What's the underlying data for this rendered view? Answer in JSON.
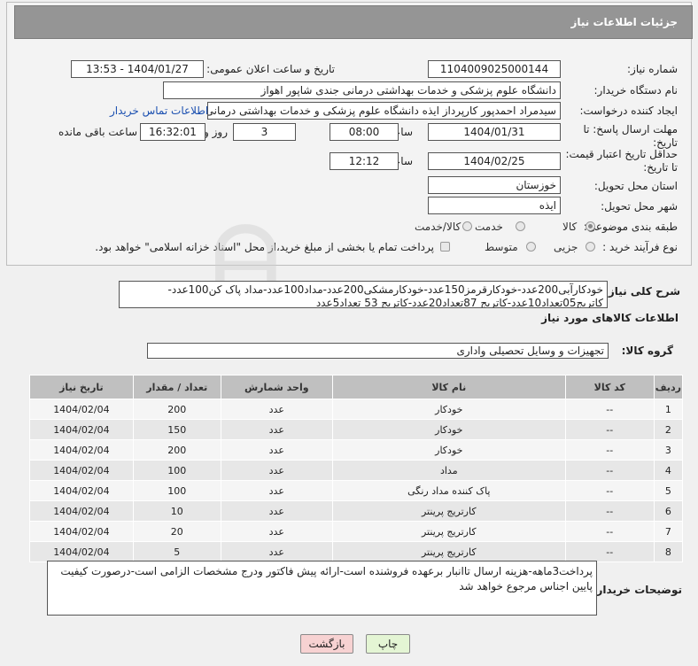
{
  "header": {
    "title": "جزئیات اطلاعات نیاز"
  },
  "fields": {
    "need_number_label": "شماره نیاز:",
    "need_number": "1104009025000144",
    "announce_label": "تاریخ و ساعت اعلان عمومی:",
    "announce_value": "1404/01/27 - 13:53",
    "buyer_org_label": "نام دستگاه خریدار:",
    "buyer_org": "دانشگاه علوم پزشکی و خدمات بهداشتی درمانی جندی شاپور اهواز",
    "creator_label": "ایجاد کننده درخواست:",
    "creator": "سیدمراد احمدپور کارپرداز ایذه دانشگاه علوم پزشکی و خدمات بهداشتی درمانی",
    "contact_link": "اطلاعات تماس خریدار",
    "deadline_label_1": "مهلت ارسال پاسخ: تا",
    "deadline_label_2": "تاریخ:",
    "deadline_date": "1404/01/31",
    "time_label": "ساعت",
    "deadline_time": "08:00",
    "days_value": "3",
    "days_label": "روز و",
    "remaining_time": "16:32:01",
    "remaining_label": "ساعت باقی مانده",
    "validity_label_1": "حداقل تاریخ اعتبار قیمت:",
    "validity_label_2": "تا تاریخ:",
    "validity_date": "1404/02/25",
    "validity_time": "12:12",
    "province_label": "استان محل تحویل:",
    "province": "خوزستان",
    "city_label": "شهر محل تحویل:",
    "city": "ایذه",
    "category_label": "طبقه بندی موضوعی:",
    "category_options": [
      "کالا",
      "خدمت",
      "کالا/خدمت"
    ],
    "process_label": "نوع فرآیند خرید :",
    "process_options": [
      "جزیی",
      "متوسط"
    ],
    "payment_note": "پرداخت تمام یا بخشی از مبلغ خرید،از محل \"اسناد خزانه اسلامی\" خواهد بود."
  },
  "description": {
    "label": "شرح کلی نیاز:",
    "text": "خودکارآبی200عدد-خودکارقرمز150عدد-خودکارمشکی200عدد-مداد100عدد-مداد پاک کن100عدد-کاتریج05تعداد10عدد-کاتریج 87تعداد20عدد-کاتریج 53 تعداد5عدد"
  },
  "goods_section": {
    "title": "اطلاعات کالاهای مورد نیاز",
    "group_label": "گروه کالا:",
    "group_value": "تجهیزات و وسایل تحصیلی واداری"
  },
  "table": {
    "headers": [
      "ردیف",
      "کد کالا",
      "نام کالا",
      "واحد شمارش",
      "تعداد / مقدار",
      "تاریخ نیاز"
    ],
    "rows": [
      [
        "1",
        "--",
        "خودکار",
        "عدد",
        "200",
        "1404/02/04"
      ],
      [
        "2",
        "--",
        "خودکار",
        "عدد",
        "150",
        "1404/02/04"
      ],
      [
        "3",
        "--",
        "خودکار",
        "عدد",
        "200",
        "1404/02/04"
      ],
      [
        "4",
        "--",
        "مداد",
        "عدد",
        "100",
        "1404/02/04"
      ],
      [
        "5",
        "--",
        "پاک کننده مداد رنگی",
        "عدد",
        "100",
        "1404/02/04"
      ],
      [
        "6",
        "--",
        "کارتریج پرینتر",
        "عدد",
        "10",
        "1404/02/04"
      ],
      [
        "7",
        "--",
        "کارتریج پرینتر",
        "عدد",
        "20",
        "1404/02/04"
      ],
      [
        "8",
        "--",
        "کارتریج پرینتر",
        "عدد",
        "5",
        "1404/02/04"
      ]
    ]
  },
  "buyer_notes": {
    "label": "توضیحات خریدار:",
    "text": "پرداخت3ماهه-هزینه ارسال تاانبار برعهده فروشنده است-ارائه پیش فاکتور ودرج مشخصات الزامی است-درصورت کیفیت پایین اجناس مرجوع خواهد شد"
  },
  "buttons": {
    "print": "چاپ",
    "back": "بازگشت"
  },
  "colors": {
    "header_bg": "#959595",
    "link": "#1a4fb0",
    "back_btn": "#f7d2d2",
    "print_btn": "#e4f5d4"
  }
}
